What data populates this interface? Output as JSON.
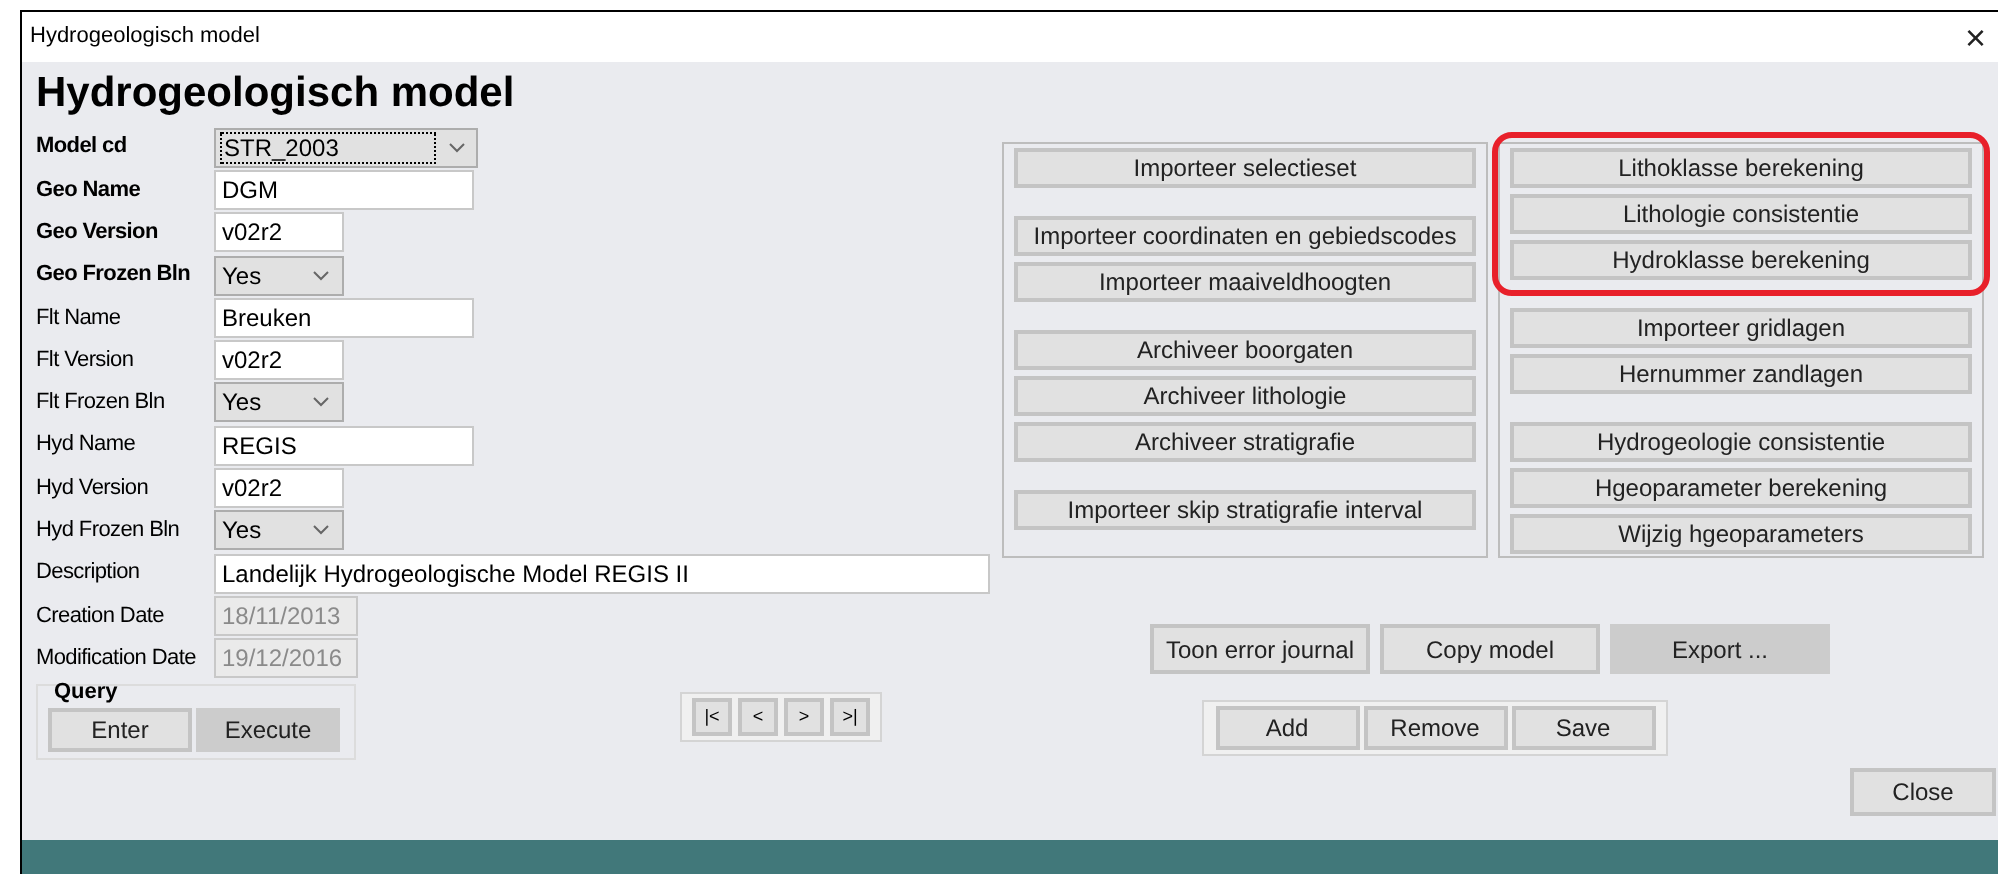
{
  "window": {
    "title": "Hydrogeologisch model",
    "close": "×"
  },
  "heading": "Hydrogeologisch model",
  "fields": [
    {
      "label": "Model cd",
      "bold": true,
      "kind": "combo",
      "value": "STR_2003",
      "focused": true
    },
    {
      "label": "Geo Name",
      "bold": true,
      "kind": "text",
      "value": "DGM"
    },
    {
      "label": "Geo Version",
      "bold": true,
      "kind": "shorttext",
      "value": "v02r2"
    },
    {
      "label": "Geo Frozen Bln",
      "bold": true,
      "kind": "select",
      "value": "Yes"
    },
    {
      "label": "Flt Name",
      "bold": false,
      "kind": "text",
      "value": "Breuken"
    },
    {
      "label": "Flt Version",
      "bold": false,
      "kind": "shorttext",
      "value": "v02r2"
    },
    {
      "label": "Flt Frozen Bln",
      "bold": false,
      "kind": "select",
      "value": "Yes"
    },
    {
      "label": "Hyd Name",
      "bold": false,
      "kind": "text",
      "value": "REGIS"
    },
    {
      "label": "Hyd Version",
      "bold": false,
      "kind": "shorttext",
      "value": "v02r2"
    },
    {
      "label": "Hyd Frozen Bln",
      "bold": false,
      "kind": "select",
      "value": "Yes"
    },
    {
      "label": "Description",
      "bold": false,
      "kind": "longtext",
      "value": "Landelijk Hydrogeologische Model REGIS II"
    },
    {
      "label": "Creation Date",
      "bold": false,
      "kind": "readonly",
      "value": "18/11/2013"
    },
    {
      "label": "Modification Date",
      "bold": false,
      "kind": "readonly",
      "value": "19/12/2016"
    }
  ],
  "query": {
    "title": "Query",
    "buttons": [
      {
        "label": "Enter",
        "pressed": false
      },
      {
        "label": "Execute",
        "pressed": true
      }
    ]
  },
  "navigation": [
    "|<",
    "<",
    ">",
    ">|"
  ],
  "panels": [
    {
      "groups": [
        {
          "highlighted": false,
          "buttons": [
            "Importeer selectieset"
          ]
        },
        {
          "highlighted": false,
          "buttons": [
            "Importeer coordinaten en gebiedscodes",
            "Importeer maaiveldhoogten"
          ]
        },
        {
          "highlighted": false,
          "buttons": [
            "Archiveer boorgaten",
            "Archiveer lithologie",
            "Archiveer stratigrafie"
          ]
        },
        {
          "highlighted": false,
          "buttons": [
            "Importeer skip stratigrafie interval"
          ]
        }
      ]
    },
    {
      "groups": [
        {
          "highlighted": true,
          "buttons": [
            "Lithoklasse berekening",
            "Lithologie consistentie",
            "Hydroklasse berekening"
          ]
        },
        {
          "highlighted": false,
          "buttons": [
            "Importeer gridlagen",
            "Hernummer zandlagen"
          ]
        },
        {
          "highlighted": false,
          "buttons": [
            "Hydrogeologie consistentie",
            "Hgeoparameter berekening",
            "Wijzig hgeoparameters"
          ]
        }
      ]
    }
  ],
  "actions": [
    {
      "label": "Toon error journal",
      "pressed": false
    },
    {
      "label": "Copy model",
      "pressed": false
    },
    {
      "label": "Export ...",
      "pressed": true
    }
  ],
  "record_buttons": [
    "Add",
    "Remove",
    "Save"
  ],
  "close_button": "Close"
}
